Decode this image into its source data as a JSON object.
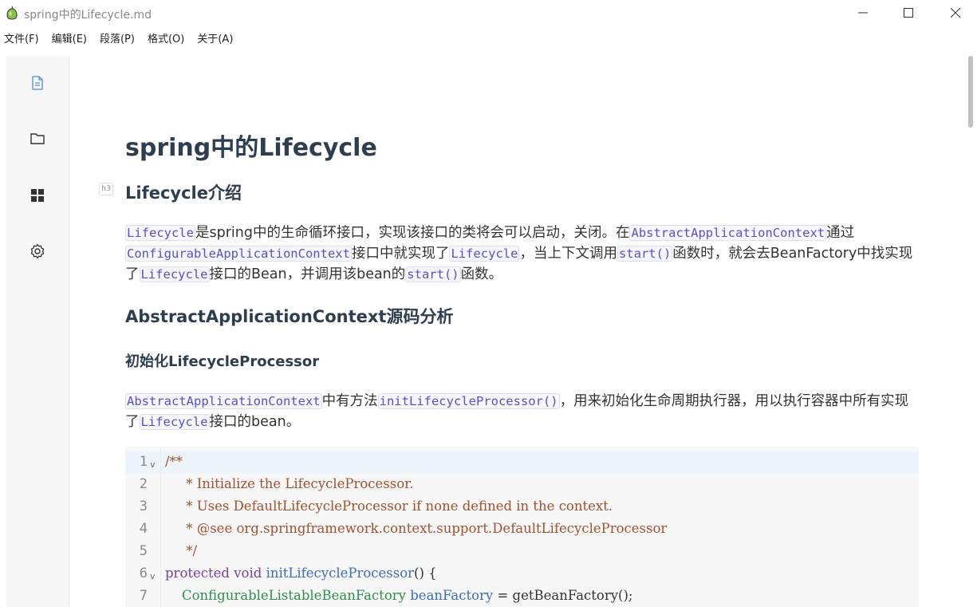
{
  "window": {
    "title": "spring中的Lifecycle.md",
    "controls": [
      "minimize",
      "maximize",
      "close"
    ]
  },
  "menu": [
    "文件(F)",
    "编辑(E)",
    "段落(P)",
    "格式(O)",
    "关于(A)"
  ],
  "sidebar": {
    "icons": [
      "document-icon",
      "folder-icon",
      "grid-icon",
      "gear-icon"
    ]
  },
  "doc": {
    "title": "spring中的Lifecycle",
    "h3_badge": "h3",
    "section1": "Lifecycle介绍",
    "para1": [
      {
        "code": "Lifecycle"
      },
      {
        "text": "是spring中的生命循环接口，实现该接口的类将会可以启动，关闭。在"
      },
      {
        "code": "AbstractApplicationContext"
      },
      {
        "text": "通过"
      },
      {
        "code": "ConfigurableApplicationContext"
      },
      {
        "text": "接口中就实现了"
      },
      {
        "code": "Lifecycle"
      },
      {
        "text": "，当上下文调用"
      },
      {
        "code": "start()"
      },
      {
        "text": "函数时，就会去BeanFactory中找实现了"
      },
      {
        "code": "Lifecycle"
      },
      {
        "text": "接口的Bean，并调用该bean的"
      },
      {
        "code": "start()"
      },
      {
        "text": "函数。"
      }
    ],
    "section2": "AbstractApplicationContext源码分析",
    "sub1": "初始化LifecycleProcessor",
    "para2": [
      {
        "code": "AbstractApplicationContext"
      },
      {
        "text": "中有方法"
      },
      {
        "code": "initLifecycleProcessor()"
      },
      {
        "text": "，用来初始化生命周期执行器，用以执行容器中所有实现了"
      },
      {
        "code": "Lifecycle"
      },
      {
        "text": "接口的bean。"
      }
    ],
    "code": {
      "line_numbers": [
        "1",
        "2",
        "3",
        "4",
        "5",
        "6",
        "7"
      ],
      "fold_marker": "v",
      "lines": [
        [
          {
            "t": "/**",
            "c": "comment"
          }
        ],
        [
          {
            "t": "     * Initialize the LifecycleProcessor.",
            "c": "comment"
          }
        ],
        [
          {
            "t": "     * Uses DefaultLifecycleProcessor if none defined in the context.",
            "c": "comment"
          }
        ],
        [
          {
            "t": "     * @see org.springframework.context.support.DefaultLifecycleProcessor",
            "c": "comment"
          }
        ],
        [
          {
            "t": "     */",
            "c": "comment"
          }
        ],
        [
          {
            "t": "protected",
            "c": "kw"
          },
          {
            "t": " ",
            "c": ""
          },
          {
            "t": "void",
            "c": "kw"
          },
          {
            "t": " ",
            "c": ""
          },
          {
            "t": "initLifecycleProcessor",
            "c": "fn"
          },
          {
            "t": "() {",
            "c": ""
          }
        ],
        [
          {
            "t": "    ",
            "c": ""
          },
          {
            "t": "ConfigurableListableBeanFactory",
            "c": "type"
          },
          {
            "t": " ",
            "c": ""
          },
          {
            "t": "beanFactory",
            "c": "var"
          },
          {
            "t": " = getBeanFactory();",
            "c": ""
          }
        ]
      ]
    }
  },
  "colors": {
    "heading": "#2c3e50",
    "inline_code": "#5a4fcf",
    "comment": "#a0522d",
    "keyword": "#7a3e9d",
    "function": "#3b6fb6",
    "type": "#2f8f4f"
  }
}
